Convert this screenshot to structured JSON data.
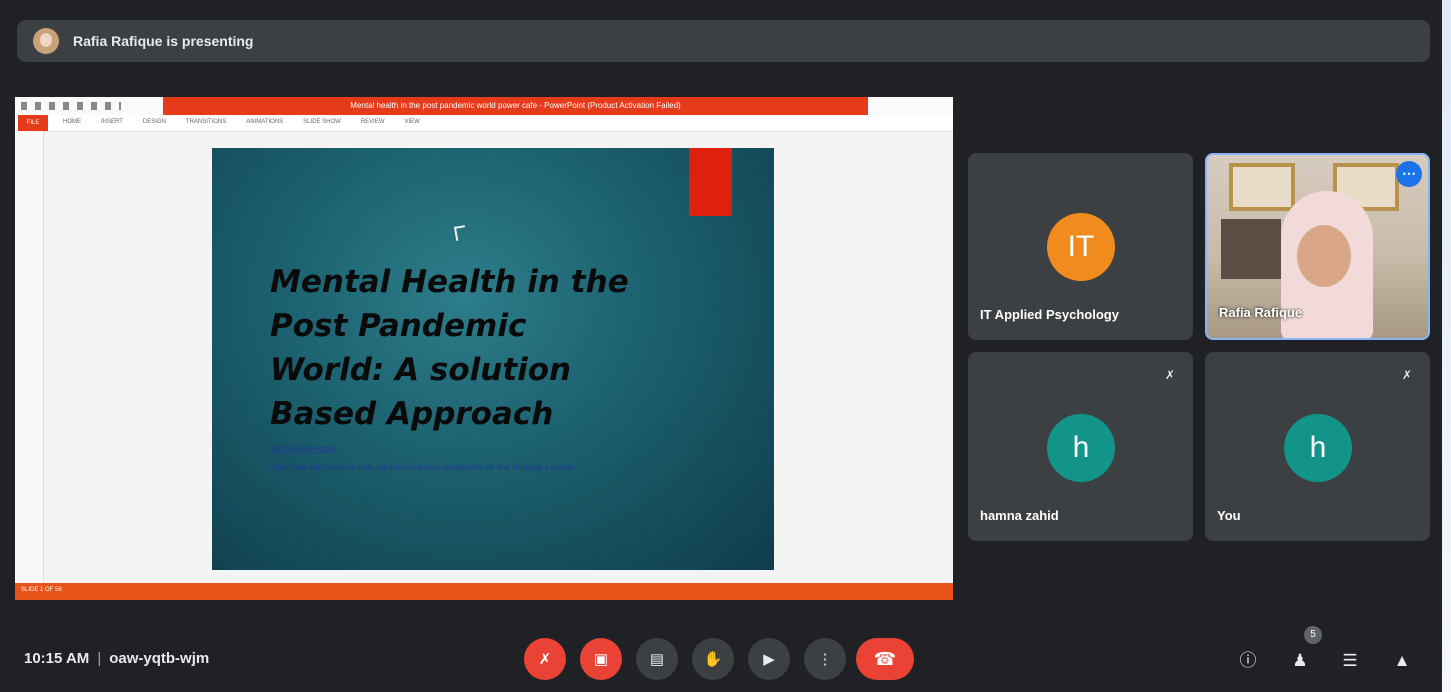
{
  "banner": {
    "text": "Rafia Rafique is presenting"
  },
  "presentation": {
    "window_title": "Mental health in the post pandemic world power cafe - PowerPoint (Product Activation Failed)",
    "file_tab": "FILE",
    "ribbon_tabs": [
      "HOME",
      "INSERT",
      "DESIGN",
      "TRANSITIONS",
      "ANIMATIONS",
      "SLIDE SHOW",
      "REVIEW",
      "VIEW"
    ],
    "status_left": "SLIDE 1 OF 56",
    "slide": {
      "title": "Mental Health in the Post Pandemic World: A solution Based Approach",
      "author": "DR RAFIA RAFIQUE",
      "affiliation": "DIRECTOR INSTITUTE OF APPLIED PSYCHOLOGY UNIVERSITY OF THE PUNJAB, LAHORE"
    }
  },
  "participants": [
    {
      "name": "IT Applied Psychology",
      "initial": "IT",
      "color": "#f28b1e"
    },
    {
      "name": "Rafia Rafique"
    },
    {
      "name": "hamna zahid",
      "initial": "h",
      "color": "#129488"
    },
    {
      "name": "You",
      "initial": "h",
      "color": "#129488"
    }
  ],
  "bottom": {
    "time": "10:15 AM",
    "separator": "|",
    "meeting_code": "oaw-yqtb-wjm",
    "people_count": "5"
  }
}
